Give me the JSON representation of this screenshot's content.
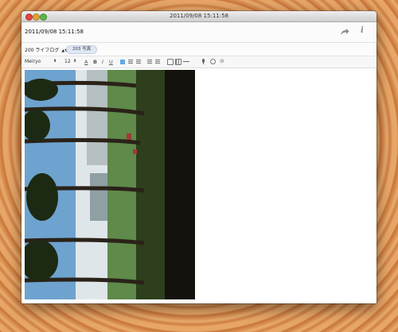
{
  "window": {
    "title": "2011/09/08 15:11:58"
  },
  "header": {
    "entry_date": "2011/09/08 15:11:58",
    "share_icon": "share-arrow-icon",
    "info_icon": "info-icon",
    "info_glyph": "i"
  },
  "tagbar": {
    "journal": "200 ライフログ",
    "journal_arrows": "▲▼",
    "tag": "203 写真"
  },
  "toolbar": {
    "font": "Meiryo",
    "font_arrows": "⬍",
    "size": "12",
    "size_arrows": "⬍",
    "bold": "B",
    "italic": "I",
    "underline": "U",
    "color": "A",
    "clip": "⊘"
  },
  "content": {
    "image_alt": "photo"
  }
}
